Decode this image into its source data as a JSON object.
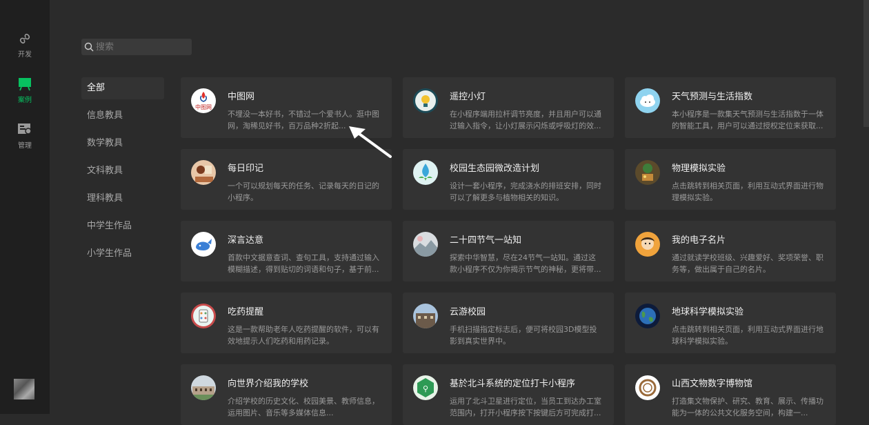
{
  "rail": {
    "items": [
      {
        "label": "开发",
        "icon": "link-icon"
      },
      {
        "label": "案例",
        "icon": "case-icon",
        "active": true
      },
      {
        "label": "管理",
        "icon": "manage-icon"
      }
    ]
  },
  "search": {
    "placeholder": "搜索"
  },
  "categories": [
    "全部",
    "信息教具",
    "数学教具",
    "文科教具",
    "理科教具",
    "中学生作品",
    "小学生作品"
  ],
  "cards": [
    {
      "title": "中图网",
      "desc": "不埋没一本好书，不错过一个爱书人。逛中图网，淘稀见好书，百万品种2折起...",
      "icon_label": "中图网"
    },
    {
      "title": "遥控小灯",
      "desc": "在小程序端用拉杆调节亮度，并且用户可以通过输入指令，让小灯展示闪烁或呼吸灯的效..."
    },
    {
      "title": "天气预测与生活指数",
      "desc": "本小程序是一款集天气预测与生活指数于一体的智能工具，用户可以通过授权定位来获取..."
    },
    {
      "title": "每日印记",
      "desc": "一个可以规划每天的任务、记录每天的日记的小程序。"
    },
    {
      "title": "校园生态园微改造计划",
      "desc": "设计一套小程序，完成浇水的排班安排，同时可以了解更多与植物相关的知识。"
    },
    {
      "title": "物理模拟实验",
      "desc": "点击跳转到相关页面，利用互动式界面进行物理模拟实验。"
    },
    {
      "title": "深言达意",
      "desc": "首款中文据意查词、查句工具，支持通过输入模糊描述，得到贴切的词语和句子，基于前..."
    },
    {
      "title": "二十四节气一站知",
      "desc": "探索中华智慧，尽在24节气一站知。通过这款小程序不仅为你揭示节气的神秘，更将带..."
    },
    {
      "title": "我的电子名片",
      "desc": "通过就读学校班级、兴趣爱好、奖项荣誉、职务等，做出属于自己的名片。"
    },
    {
      "title": "吃药提醒",
      "desc": "这是一款帮助老年人吃药提醒的软件，可以有效地提示人们吃药和用药记录。"
    },
    {
      "title": "云游校园",
      "desc": "手机扫描指定标志后，便可将校园3D模型投影到真实世界中。"
    },
    {
      "title": "地球科学模拟实验",
      "desc": "点击跳转到相关页面，利用互动式界面进行地球科学模拟实验。"
    },
    {
      "title": "向世界介绍我的学校",
      "desc": "介绍学校的历史文化、校园美景、教师信息，运用图片、音乐等多媒体信息..."
    },
    {
      "title": "基於北斗系统的定位打卡小程序",
      "desc": "运用了北斗卫星进行定位，当员工到达办工室范围内，打开小程序按下按键后方可完成打..."
    },
    {
      "title": "山西文物数字博物馆",
      "desc": "打造集文物保护、研究、教育、展示、传播功能为一体的公共文化服务空间，构建一..."
    }
  ],
  "colors": {
    "accent": "#07c160",
    "background": "#2b2b2b",
    "card": "#333333"
  }
}
